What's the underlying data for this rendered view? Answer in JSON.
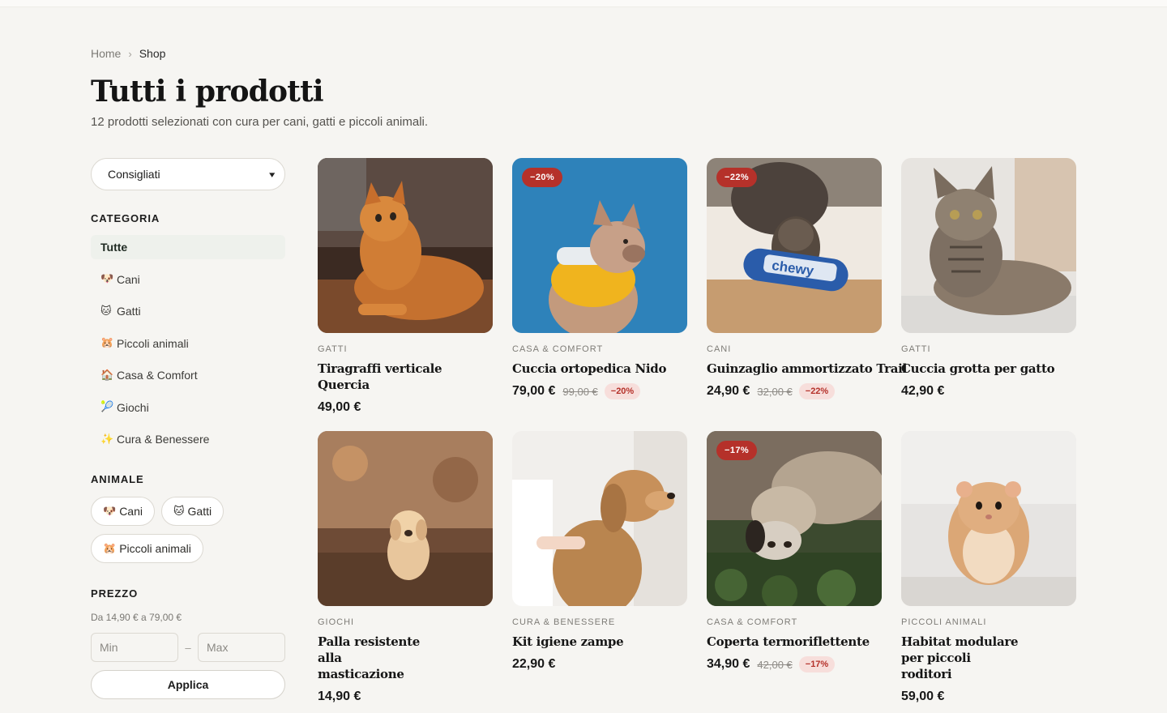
{
  "breadcrumb": {
    "home": "Home",
    "separator": "›",
    "current": "Shop"
  },
  "page": {
    "title": "Tutti i prodotti",
    "subtitle": "12 prodotti selezionati con cura per cani, gatti e piccoli animali."
  },
  "sort": {
    "selected": "Consigliati",
    "chevron_icon": "chevron-down-icon"
  },
  "filters": {
    "category_heading": "CATEGORIA",
    "categories": [
      {
        "label": "Tutte",
        "emoji": "",
        "active": true
      },
      {
        "label": "Cani",
        "emoji": "🐶",
        "active": false
      },
      {
        "label": "Gatti",
        "emoji": "🐱",
        "active": false
      },
      {
        "label": "Piccoli animali",
        "emoji": "🐹",
        "active": false
      },
      {
        "label": "Casa & Comfort",
        "emoji": "🏠",
        "active": false
      },
      {
        "label": "Giochi",
        "emoji": "🎾",
        "active": false
      },
      {
        "label": "Cura & Benessere",
        "emoji": "✨",
        "active": false
      }
    ],
    "animal_heading": "ANIMALE",
    "animals": [
      {
        "label": "Cani",
        "emoji": "🐶"
      },
      {
        "label": "Gatti",
        "emoji": "🐱"
      },
      {
        "label": "Piccoli animali",
        "emoji": "🐹"
      }
    ],
    "price_heading": "PREZZO",
    "price_range": "Da 14,90 € a 79,00 €",
    "min_placeholder": "Min",
    "max_placeholder": "Max",
    "dash": "–",
    "apply_label": "Applica"
  },
  "products": [
    {
      "category": "GATTI",
      "name": "Tiragraffi verticale Quercia",
      "price": "49,00 €",
      "old_price": "",
      "discount": "",
      "image": "orange-cat-photo"
    },
    {
      "category": "CASA & COMFORT",
      "name": "Cuccia ortopedica Nido",
      "price": "79,00 €",
      "old_price": "99,00 €",
      "discount": "−20%",
      "image": "bulldog-photo"
    },
    {
      "category": "CANI",
      "name": "Guinzaglio ammortizzato Trail",
      "price": "24,90 €",
      "old_price": "32,00 €",
      "discount": "−22%",
      "image": "dog-chewing-photo"
    },
    {
      "category": "GATTI",
      "name": "Cuccia grotta per gatto",
      "price": "42,90 €",
      "old_price": "",
      "discount": "",
      "image": "tabby-cat-photo"
    },
    {
      "category": "GIOCHI",
      "name": "Palla resistente alla masticazione",
      "price": "14,90 €",
      "old_price": "",
      "discount": "",
      "image": "puppy-running-photo"
    },
    {
      "category": "CURA & BENESSERE",
      "name": "Kit igiene zampe",
      "price": "22,90 €",
      "old_price": "",
      "discount": "",
      "image": "golden-retriever-photo"
    },
    {
      "category": "CASA & COMFORT",
      "name": "Coperta termoriflettente",
      "price": "34,90 €",
      "old_price": "42,00 €",
      "discount": "−17%",
      "image": "cat-and-dog-photo"
    },
    {
      "category": "PICCOLI ANIMALI",
      "name": "Habitat modulare per piccoli roditori",
      "price": "59,00 €",
      "old_price": "",
      "discount": "",
      "image": "hamster-photo"
    }
  ],
  "colors": {
    "background": "#f6f5f2",
    "discount_badge": "#b5312a",
    "discount_pill_bg": "#f7dedb",
    "active_category_bg": "#eef1ec"
  }
}
